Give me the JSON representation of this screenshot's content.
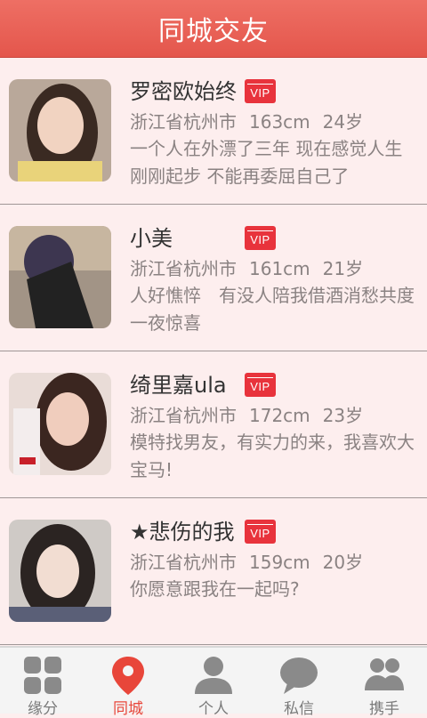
{
  "header": {
    "title": "同城交友"
  },
  "badge_label": "VIP",
  "users": [
    {
      "name": "罗密欧始终",
      "location": "浙江省杭州市",
      "height": "163cm",
      "age": "24岁",
      "bio": "一个人在外漂了三年 现在感觉人生刚刚起步 不能再委屈自己了"
    },
    {
      "name": "小美",
      "location": "浙江省杭州市",
      "height": "161cm",
      "age": "21岁",
      "bio": "人好憔悴　有没人陪我借酒消愁共度一夜惊喜"
    },
    {
      "name": "绮里嘉ula",
      "location": "浙江省杭州市",
      "height": "172cm",
      "age": "23岁",
      "bio": "模特找男友，有实力的来，我喜欢大宝马!"
    },
    {
      "name": "★悲伤的我",
      "location": "浙江省杭州市",
      "height": "159cm",
      "age": "20岁",
      "bio": "你愿意跟我在一起吗?"
    }
  ],
  "tabs": [
    {
      "label": "缘分",
      "icon": "grid-icon"
    },
    {
      "label": "同城",
      "icon": "location-pin-icon",
      "active": true
    },
    {
      "label": "个人",
      "icon": "person-icon"
    },
    {
      "label": "私信",
      "icon": "message-icon"
    },
    {
      "label": "携手",
      "icon": "couple-icon"
    }
  ],
  "colors": {
    "header": "#e85a50",
    "accent": "#e8463a",
    "vip": "#e8333c",
    "background": "#fdeeee"
  }
}
